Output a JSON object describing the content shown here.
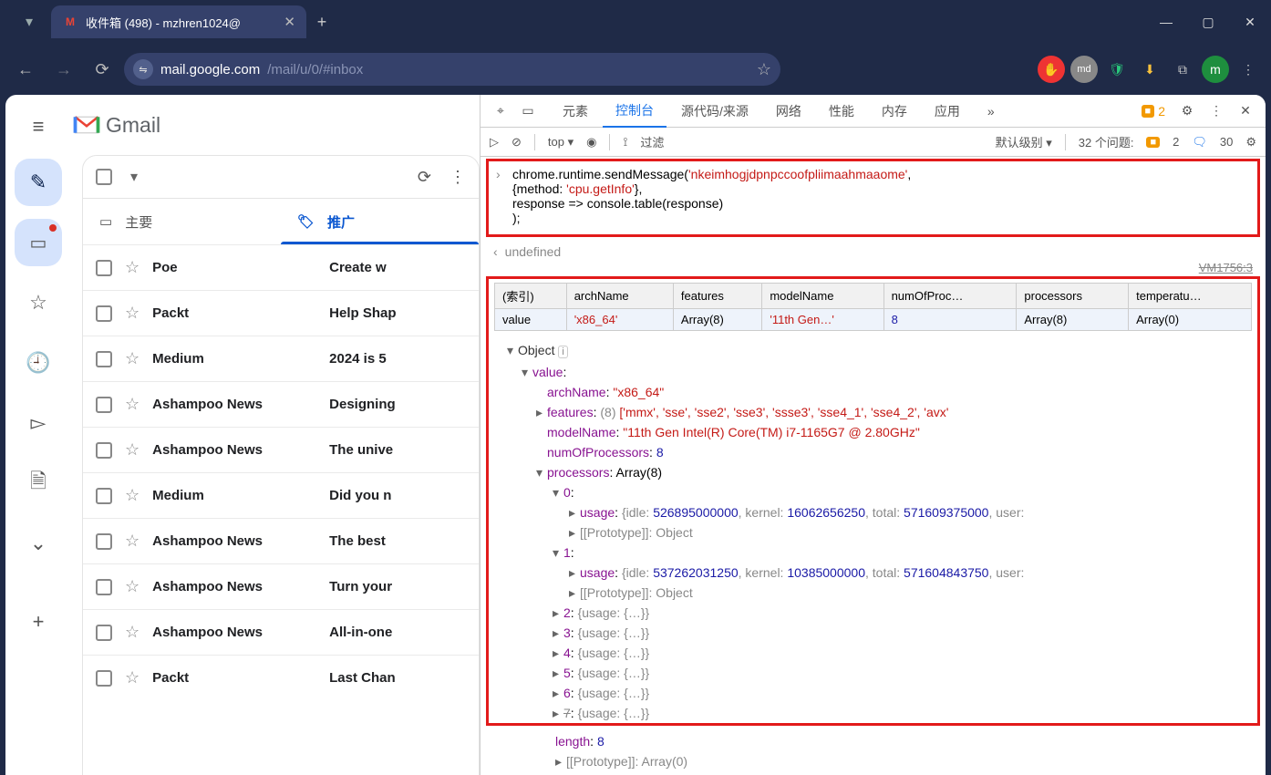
{
  "window": {
    "tab_title": "收件箱 (498) - mzhren1024@",
    "url_host": "mail.google.com",
    "url_path": "/mail/u/0/#inbox"
  },
  "gmail": {
    "product": "Gmail",
    "tabs": {
      "primary": "主要",
      "promotions": "推广"
    },
    "rows": [
      {
        "sender": "Poe",
        "subject": "Create w"
      },
      {
        "sender": "Packt",
        "subject": "Help Shap"
      },
      {
        "sender": "Medium",
        "subject": "2024 is 5"
      },
      {
        "sender": "Ashampoo News",
        "subject": "Designing"
      },
      {
        "sender": "Ashampoo News",
        "subject": "The unive"
      },
      {
        "sender": "Medium",
        "subject": "Did you n"
      },
      {
        "sender": "Ashampoo News",
        "subject": "The best"
      },
      {
        "sender": "Ashampoo News",
        "subject": "Turn your"
      },
      {
        "sender": "Ashampoo News",
        "subject": "All-in-one"
      },
      {
        "sender": "Packt",
        "subject": "Last Chan"
      }
    ]
  },
  "devtools": {
    "tabs": {
      "elements": "元素",
      "console": "控制台",
      "sources": "源代码/来源",
      "network": "网络",
      "performance": "性能",
      "memory": "内存",
      "application": "应用",
      "more": "»"
    },
    "issues": {
      "badge": "2",
      "questions_label": "32 个问题:",
      "warn": "2",
      "info": "30"
    },
    "subbar": {
      "context": "top",
      "filter": "过滤",
      "level": "默认级别"
    },
    "code": {
      "l1a": "chrome.runtime.sendMessage(",
      "l1b": "'nkeimhogjdpnpccoofpliimaahmaaome'",
      "l1c": ",",
      "l2a": "  {method: ",
      "l2b": "'cpu.getInfo'",
      "l2c": "},",
      "l3": "  response => console.table(response)",
      "l4": ");"
    },
    "undefined": "undefined",
    "vmlink": "VM1756:3",
    "table": {
      "headers": [
        "(索引)",
        "archName",
        "features",
        "modelName",
        "numOfProc…",
        "processors",
        "temperatu…"
      ],
      "row": [
        "value",
        "'x86_64'",
        "Array(8)",
        "'11th Gen…'",
        "8",
        "Array(8)",
        "Array(0)"
      ]
    },
    "tree": {
      "object": "Object",
      "value": "value",
      "archName_k": "archName",
      "archName_v": "\"x86_64\"",
      "features_k": "features",
      "features_count": "(8)",
      "features_arr": "['mmx', 'sse', 'sse2', 'sse3', 'ssse3', 'sse4_1', 'sse4_2', 'avx'",
      "modelName_k": "modelName",
      "modelName_v": "\"11th Gen Intel(R) Core(TM) i7-1165G7 @ 2.80GHz\"",
      "numProc_k": "numOfProcessors",
      "numProc_v": "8",
      "processors_k": "processors",
      "processors_v": "Array(8)",
      "p0": "0",
      "p0_usage": "usage",
      "p0_vals": "{idle: 526895000000, kernel: 16062656250, total: 571609375000, user:",
      "p0_proto": "[[Prototype]]: Object",
      "p1": "1",
      "p1_usage": "usage",
      "p1_vals": "{idle: 537262031250, kernel: 10385000000, total: 571604843750, user:",
      "p1_proto": "[[Prototype]]: Object",
      "p2": "2",
      "p2_sum": "{usage: {…}}",
      "p3": "3",
      "p3_sum": "{usage: {…}}",
      "p4": "4",
      "p4_sum": "{usage: {…}}",
      "p5": "5",
      "p5_sum": "{usage: {…}}",
      "p6": "6",
      "p6_sum": "{usage: {…}}",
      "p7": "7",
      "p7_sum": "{usage: {…}}",
      "length_k": "length",
      "length_v": "8",
      "arr_proto": "[[Prototype]]: Array(0)"
    }
  }
}
